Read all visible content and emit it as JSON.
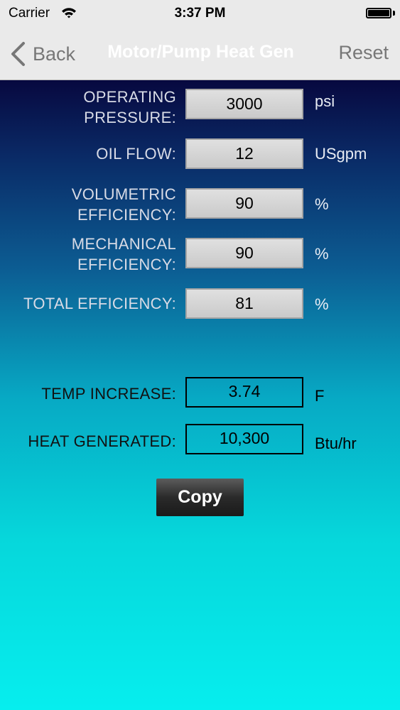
{
  "status_bar": {
    "carrier": "Carrier",
    "time": "3:37 PM"
  },
  "nav": {
    "back_label": "Back",
    "title": "Motor/Pump Heat Gen",
    "reset_label": "Reset"
  },
  "inputs": [
    {
      "label": "OPERATING\nPRESSURE:",
      "value": "3000",
      "unit": "psi"
    },
    {
      "label": "OIL FLOW:",
      "value": "12",
      "unit": "USgpm"
    },
    {
      "label": "VOLUMETRIC\nEFFICIENCY:",
      "value": "90",
      "unit": "%"
    },
    {
      "label": "MECHANICAL\nEFFICIENCY:",
      "value": "90",
      "unit": "%"
    },
    {
      "label": "TOTAL EFFICIENCY:",
      "value": "81",
      "unit": "%"
    }
  ],
  "results": [
    {
      "label": "TEMP INCREASE:",
      "value": "3.74",
      "unit": "F"
    },
    {
      "label": "HEAT GENERATED:",
      "value": "10,300",
      "unit": "Btu/hr"
    }
  ],
  "copy_button": {
    "label": "Copy"
  }
}
